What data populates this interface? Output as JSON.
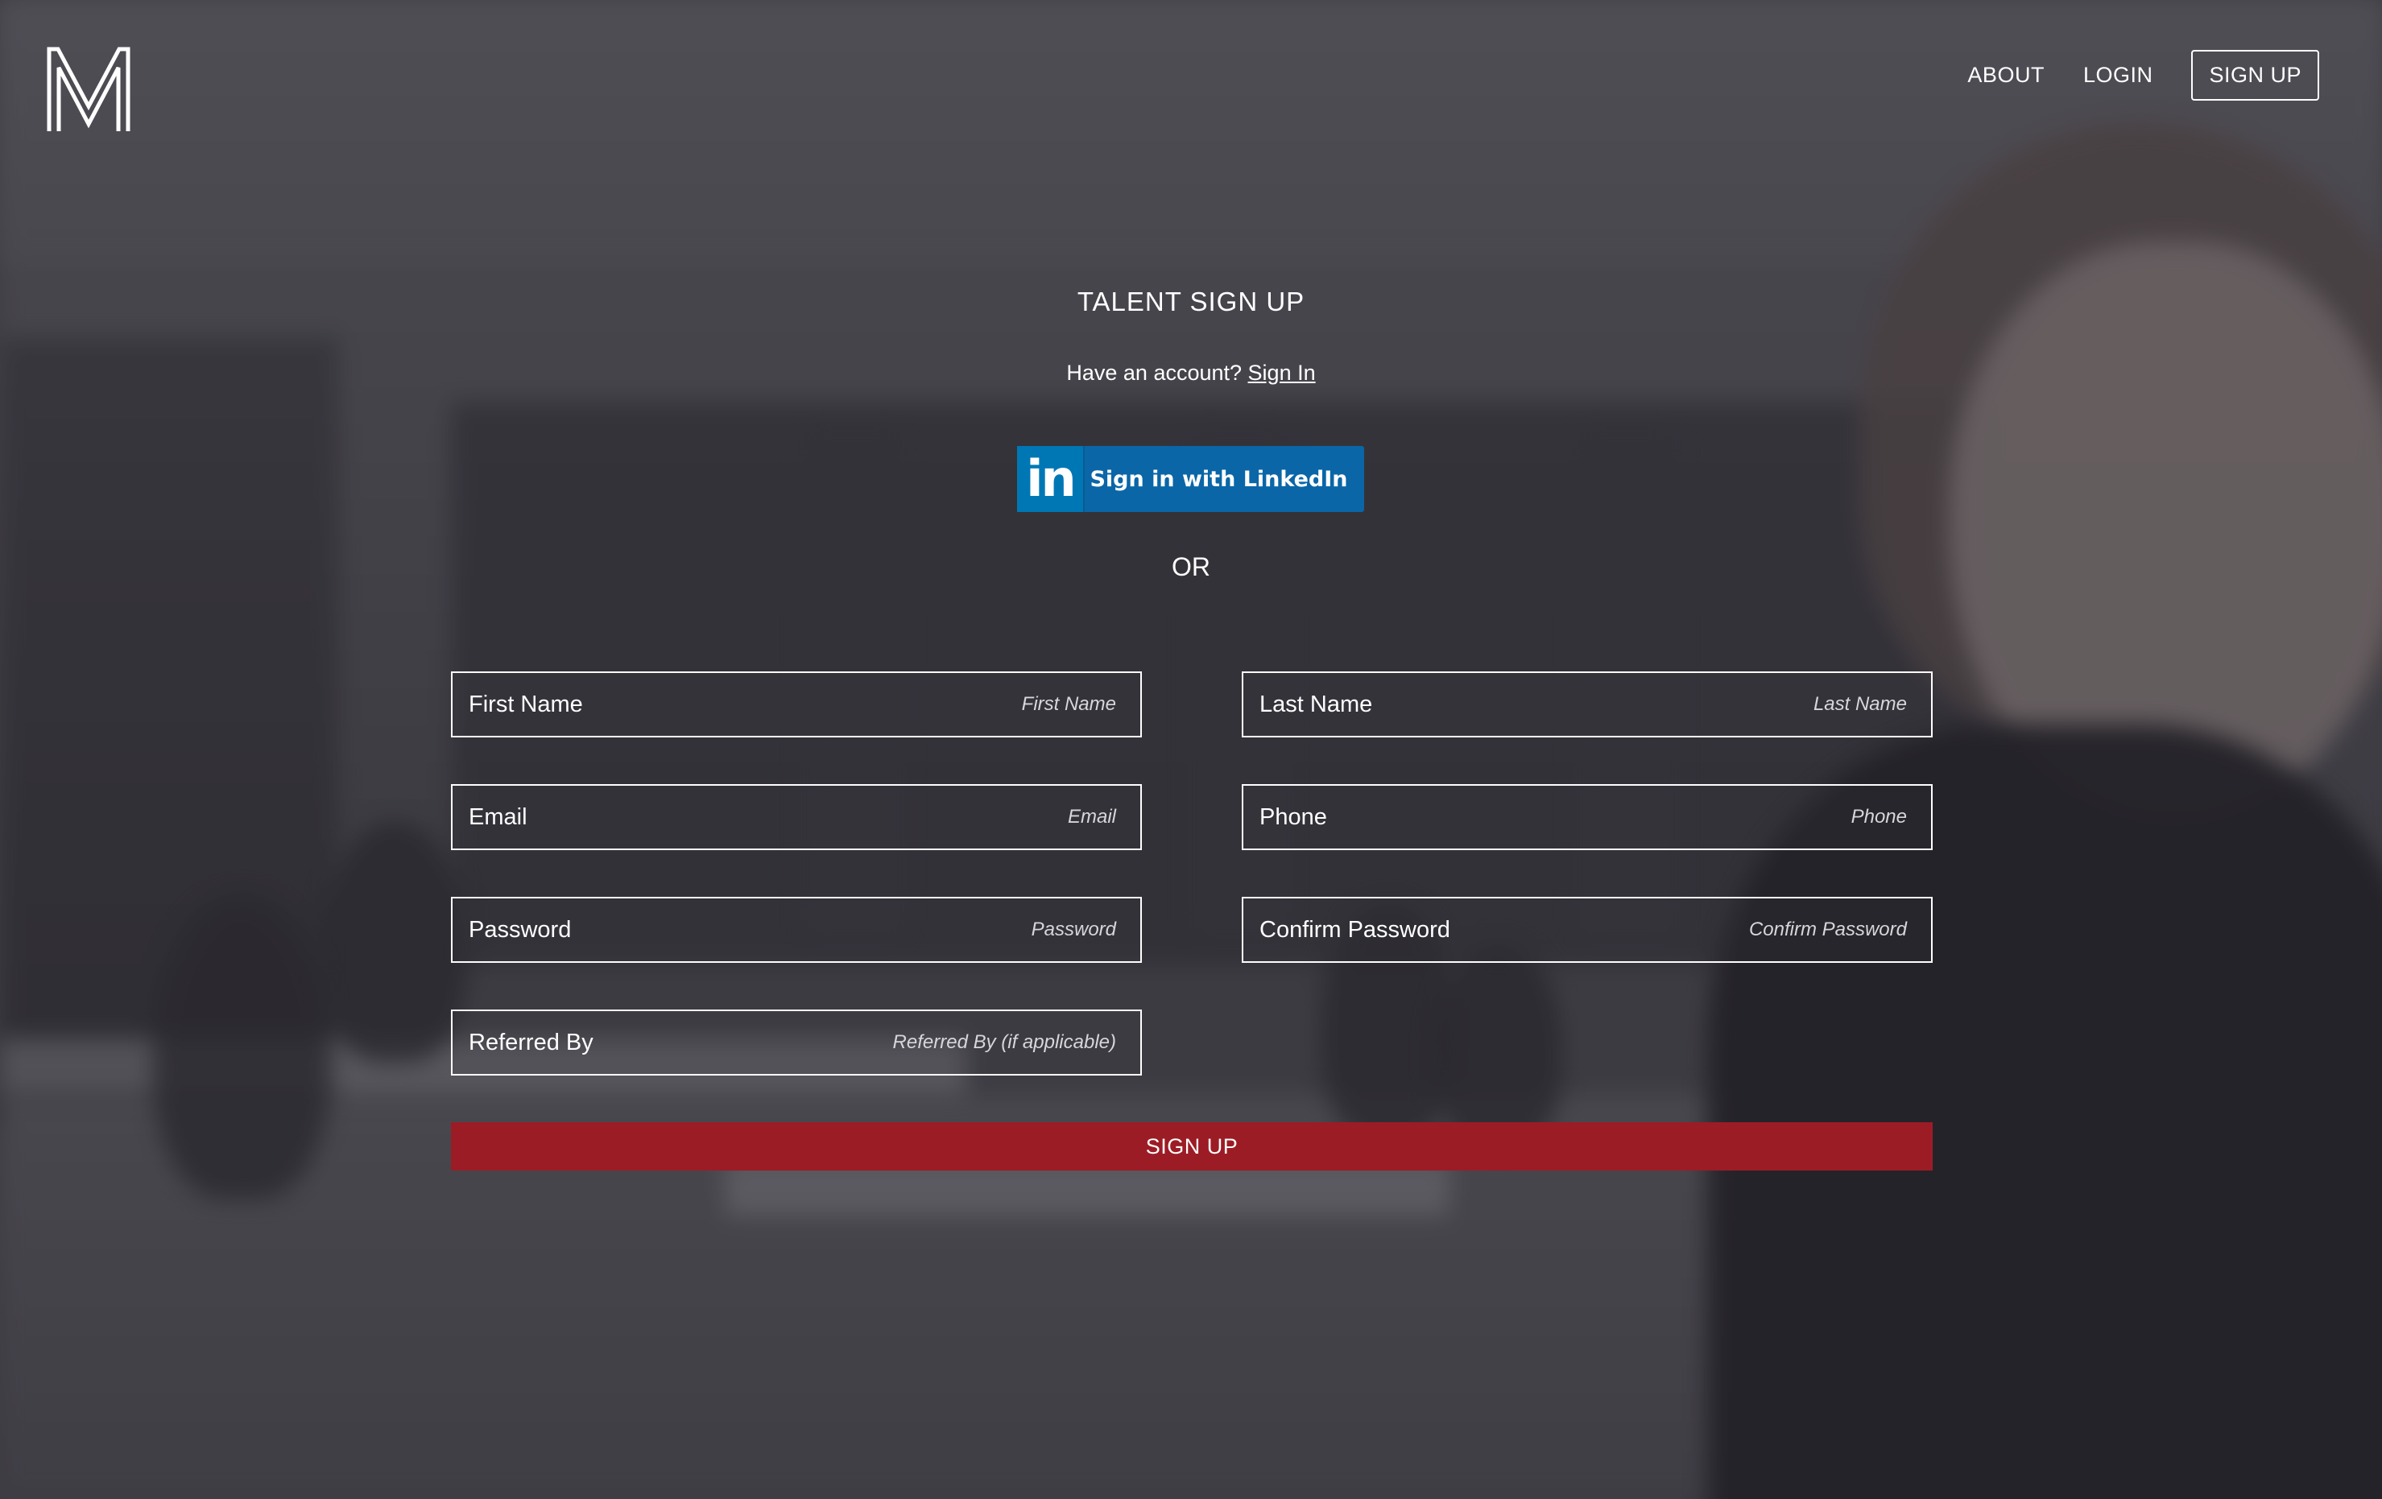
{
  "header": {
    "logo_letter": "M",
    "nav": {
      "about": "ABOUT",
      "login": "LOGIN",
      "signup": "SIGN UP"
    }
  },
  "main": {
    "title": "TALENT SIGN UP",
    "have_account_text": "Have an account?",
    "sign_in_link": "Sign In",
    "linkedin": {
      "logo_text": "in",
      "label": "Sign in with LinkedIn"
    },
    "or_text": "OR"
  },
  "form": {
    "first_name": {
      "label": "First Name",
      "placeholder": "First Name"
    },
    "last_name": {
      "label": "Last Name",
      "placeholder": "Last Name"
    },
    "email": {
      "label": "Email",
      "placeholder": "Email"
    },
    "phone": {
      "label": "Phone",
      "placeholder": "Phone"
    },
    "password": {
      "label": "Password",
      "placeholder": "Password"
    },
    "confirm_password": {
      "label": "Confirm Password",
      "placeholder": "Confirm Password"
    },
    "referred_by": {
      "label": "Referred By",
      "placeholder": "Referred By (if applicable)"
    },
    "submit_label": "SIGN UP"
  },
  "colors": {
    "submit_button": "#9c1c25",
    "linkedin_blue": "#0a66a7",
    "overlay": "#4b4a50"
  }
}
